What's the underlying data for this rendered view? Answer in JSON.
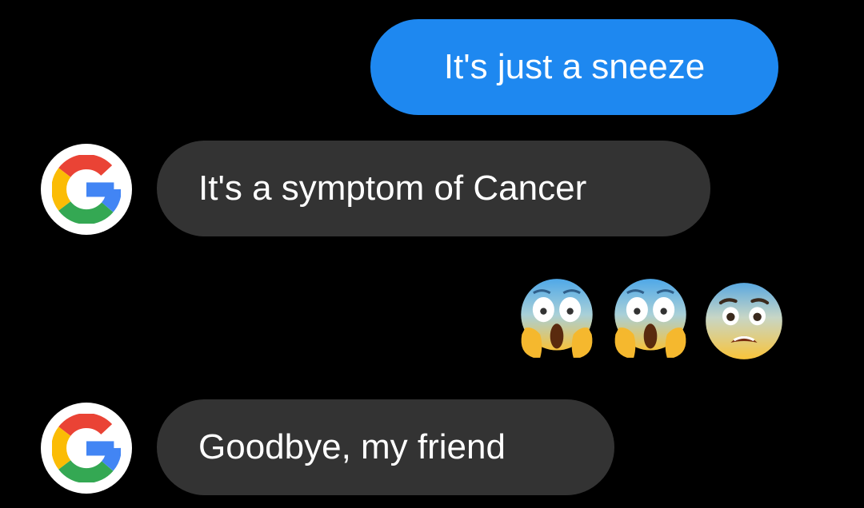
{
  "theme": {
    "background": "#000000",
    "outgoing_bubble": "#1E88F0",
    "incoming_bubble": "#333333",
    "text": "#FFFFFF"
  },
  "messages": [
    {
      "sender": "me",
      "text": "It's just a sneeze"
    },
    {
      "sender": "google",
      "avatar_icon": "google-g-icon",
      "text": "It's a symptom of Cancer"
    },
    {
      "sender": "me",
      "emojis": [
        "face-screaming-in-fear-icon",
        "face-screaming-in-fear-icon",
        "anxious-face-icon"
      ]
    },
    {
      "sender": "google",
      "avatar_icon": "google-g-icon",
      "text": "Goodbye, my friend"
    }
  ]
}
